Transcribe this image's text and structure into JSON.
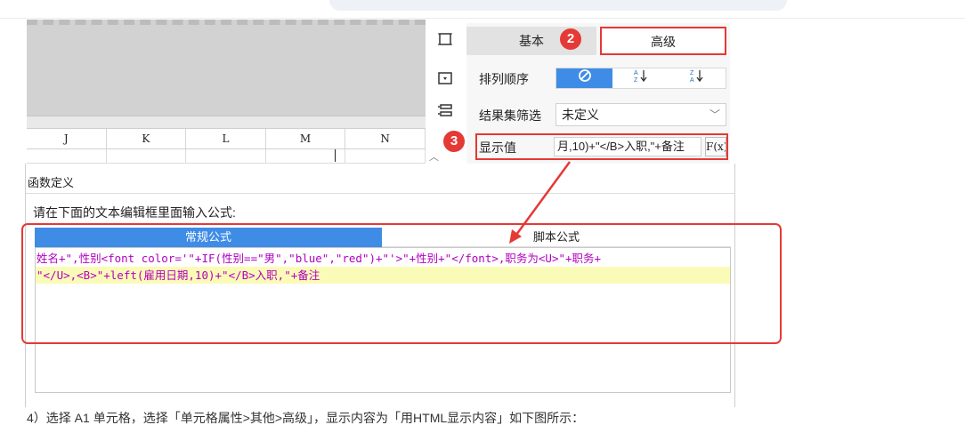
{
  "sheet": {
    "columns": [
      "J",
      "K",
      "L",
      "M",
      "N"
    ]
  },
  "toolbar": {
    "icons": [
      "square-outline-icon",
      "dropdown-box-icon",
      "list-panel-icon"
    ]
  },
  "panel": {
    "tab_basic": "基本",
    "tab_advanced": "高级",
    "sort_label": "排列顺序",
    "sort_options": [
      "⊘",
      "A→Z",
      "Z→A"
    ],
    "filter_label": "结果集筛选",
    "filter_value": "未定义",
    "display_label": "显示值",
    "display_value": "月,10)+\"</B>入职,\"+备注",
    "fx_label": "F(x)"
  },
  "badges": {
    "two": "2",
    "three": "3"
  },
  "dialog": {
    "title": "函数定义",
    "prompt": "请在下面的文本编辑框里面输入公式:",
    "tab_normal": "常规公式",
    "tab_script": "脚本公式",
    "code_line1": "姓名+\",性别<font color='\"+IF(性别==\"男\",\"blue\",\"red\")+\"'>\"+性别+\"</font>,职务为<U>\"+职务+",
    "code_line2": "\"</U>,<B>\"+left(雇用日期,10)+\"</B>入职,\"+备注"
  },
  "bottom_text": "4）选择 A1 单元格，选择「单元格属性>其他>高级」，显示内容为「用HTML显示内容」如下图所示："
}
